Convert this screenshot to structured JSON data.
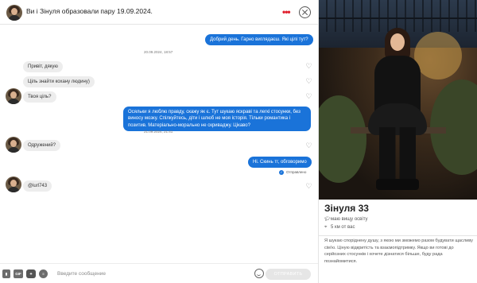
{
  "header": {
    "title": "Ви і Зінуля образовали пару 19.09.2024.",
    "more_icon": "more-dots-icon",
    "close_icon": "close-icon"
  },
  "messages": {
    "m1": {
      "direction": "out",
      "text": "Добрий день. Гарно виглядаєш. Які цілі тут?"
    },
    "d1": "20.09.2024, 18:57",
    "m2": {
      "direction": "in",
      "text": "Привіт, дякую"
    },
    "m3": {
      "direction": "in",
      "text": "Ціль знайти кохану людину)"
    },
    "m4": {
      "direction": "in",
      "text": "Твоя ціль?"
    },
    "m5": {
      "direction": "out",
      "text": "Осяльки я люблю правду, скажу як є. Тут шукаю яскраві та легкі стосунки, без виносу мозку. Спілкуйтесь, діти і шлюб не моя історія. Тільки романтика і позитив. Матеріально-морально не скриваджу. Цікаво?"
    },
    "d2": "21.09.2024, 21:41",
    "m6": {
      "direction": "in",
      "text": "Одружений?"
    },
    "m7": {
      "direction": "out",
      "text": "Ні. Скинь тг, обговоримо"
    },
    "m7_status": "Отправлено",
    "m8": {
      "direction": "in",
      "text": "@iurl743"
    }
  },
  "composer": {
    "gif_label": "GIF",
    "placeholder": "Введите сообщение",
    "send_label": "ОТПРАВИТЬ"
  },
  "profile": {
    "name": "Зінуля 33",
    "education": "маю вищу освіту",
    "distance": "5 км от вас",
    "bio": "Я шукаю споріднену душу, з якою ми зможемо разом будувати щасливу сім'ю. Ціную відкритість та взаємопідтримку. Якщо ви готові до серйозних стосунків і хочете дізнатися більше, буду рада познайомитися."
  },
  "colors": {
    "outgoing_bubble": "#1a73d9",
    "incoming_bubble": "#ededed",
    "more_dots": "#e0202e"
  }
}
